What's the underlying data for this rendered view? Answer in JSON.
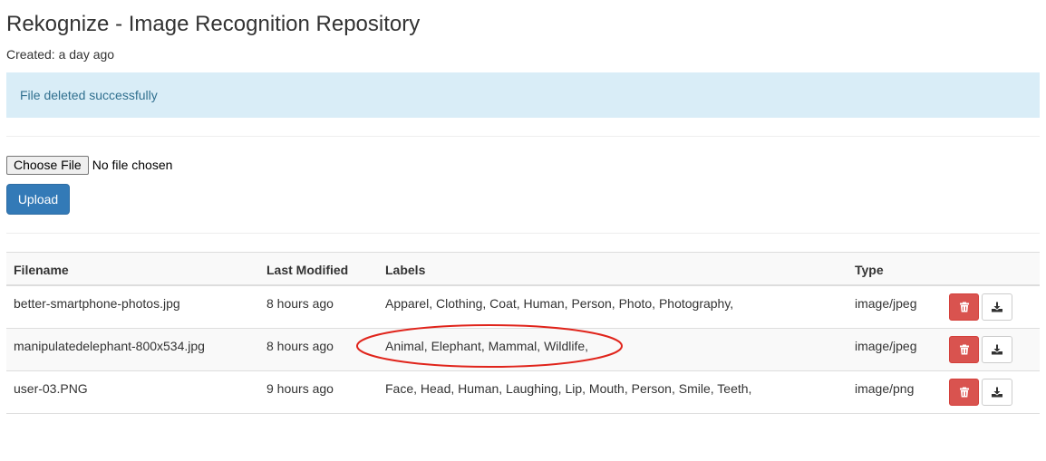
{
  "header": {
    "title": "Rekognize - Image Recognition Repository",
    "created": "Created: a day ago"
  },
  "alert": {
    "message": "File deleted successfully"
  },
  "upload_form": {
    "choose_file_label": "Choose File",
    "no_file_text": "No file chosen",
    "upload_label": "Upload"
  },
  "table": {
    "headers": {
      "filename": "Filename",
      "last_modified": "Last Modified",
      "labels": "Labels",
      "type": "Type"
    },
    "rows": [
      {
        "filename": "better-smartphone-photos.jpg",
        "last_modified": "8 hours ago",
        "labels": "Apparel, Clothing, Coat, Human, Person, Photo, Photography,",
        "type": "image/jpeg"
      },
      {
        "filename": "manipulatedelephant-800x534.jpg",
        "last_modified": "8 hours ago",
        "labels": "Animal, Elephant, Mammal, Wildlife,",
        "type": "image/jpeg"
      },
      {
        "filename": "user-03.PNG",
        "last_modified": "9 hours ago",
        "labels": "Face, Head, Human, Laughing, Lip, Mouth, Person, Smile, Teeth,",
        "type": "image/png"
      }
    ]
  },
  "icons": {
    "delete": "trash-icon",
    "download": "download-icon"
  },
  "colors": {
    "alert_background": "#d9edf7",
    "alert_text": "#31708f",
    "upload_button": "#337ab7",
    "delete_button": "#d9534f",
    "highlight_annotation": "#e0241b"
  }
}
